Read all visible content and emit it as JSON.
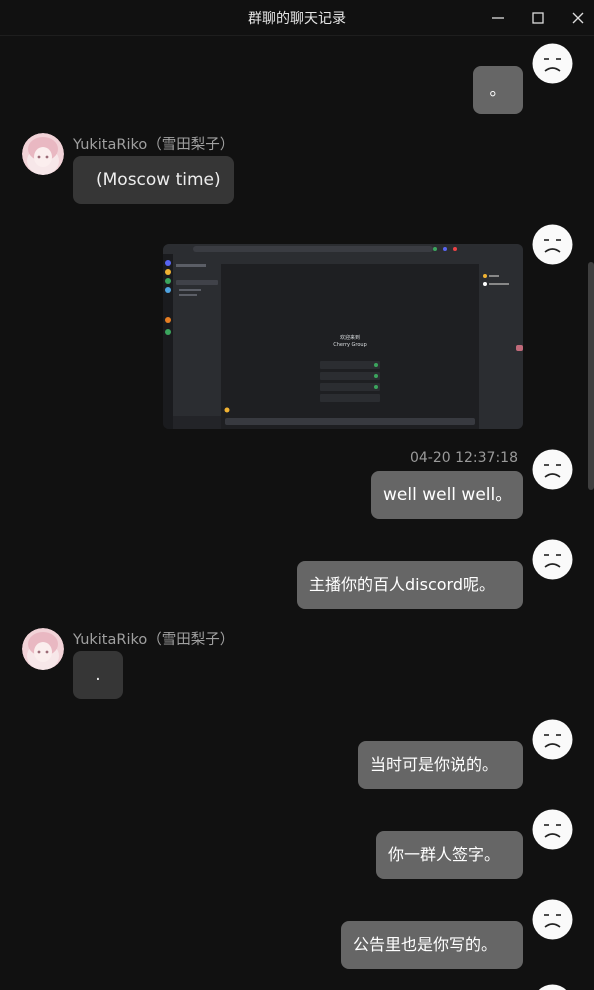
{
  "window": {
    "title": "群聊的聊天记录"
  },
  "messages": [
    {
      "text": "。"
    },
    {
      "sender": "YukitaRiko（雪田梨子）",
      "text": "(Moscow time)"
    },
    {
      "image": "screenshot-of-discord-server",
      "screenshot_texts": {
        "heading": "欢迎来到",
        "server_name": "Cherry Group"
      }
    },
    {
      "timestamp": "04-20 12:37:18",
      "text": "well well well。"
    },
    {
      "text": "主播你的百人discord呢。"
    },
    {
      "sender": "YukitaRiko（雪田梨子）",
      "text": "."
    },
    {
      "text": "当时可是你说的。"
    },
    {
      "text": "你一群人签字。"
    },
    {
      "text": "公告里也是你写的。"
    }
  ],
  "icons": {
    "minimize": "minimize-icon",
    "maximize": "maximize-icon",
    "close": "close-icon",
    "self_avatar": "sad-face-avatar",
    "other_avatar": "anime-girl-avatar"
  },
  "colors": {
    "background": "#111111",
    "my_bubble": "#666666",
    "their_bubble": "#363636"
  }
}
